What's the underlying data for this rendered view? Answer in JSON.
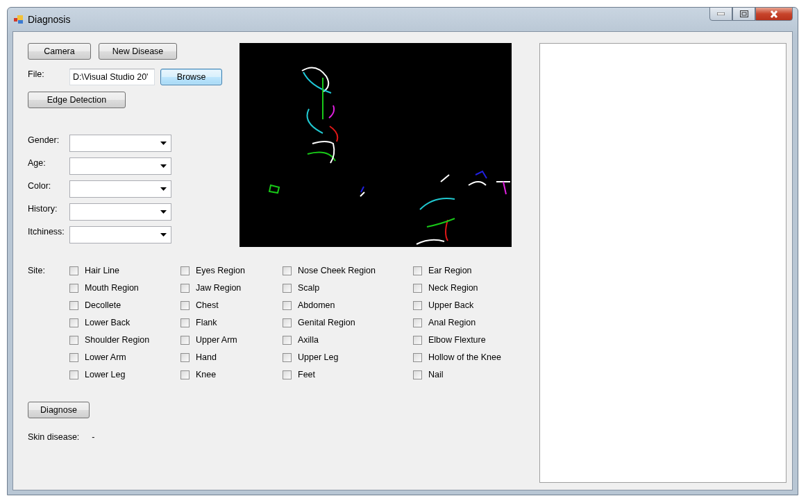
{
  "window": {
    "title": "Diagnosis"
  },
  "top_buttons": [
    "Camera",
    "New Disease"
  ],
  "file": {
    "label": "File:",
    "value": "D:\\Visual Studio 20'",
    "button": "Browse"
  },
  "edge_button": "Edge Detection",
  "preview": {
    "kind": "picture"
  },
  "fields": [
    {
      "label": "Gender:"
    },
    {
      "label": "Age:"
    },
    {
      "label": "Color:"
    },
    {
      "label": "History:"
    },
    {
      "label": "Itchiness:"
    }
  ],
  "site_label": "Site:",
  "sites": [
    [
      {
        "label": "Hair Line",
        "checked": false
      },
      {
        "label": "Eyes Region",
        "checked": false
      },
      {
        "label": "Nose Cheek Region",
        "checked": false
      },
      {
        "label": "Ear Region",
        "checked": false
      }
    ],
    [
      {
        "label": "Mouth Region",
        "checked": false
      },
      {
        "label": "Jaw Region",
        "checked": false
      },
      {
        "label": "Scalp",
        "checked": false
      },
      {
        "label": "Neck Region",
        "checked": false
      }
    ],
    [
      {
        "label": "Decollete",
        "checked": false
      },
      {
        "label": "Chest",
        "checked": false
      },
      {
        "label": "Abdomen",
        "checked": false
      },
      {
        "label": "Upper Back",
        "checked": false
      }
    ],
    [
      {
        "label": "Lower Back",
        "checked": false
      },
      {
        "label": "Flank",
        "checked": false
      },
      {
        "label": "Genital Region",
        "checked": false
      },
      {
        "label": "Anal Region",
        "checked": false
      }
    ],
    [
      {
        "label": "Shoulder Region",
        "checked": false
      },
      {
        "label": "Upper Arm",
        "checked": false
      },
      {
        "label": "Axilla",
        "checked": false
      },
      {
        "label": "Elbow Flexture",
        "checked": false
      }
    ],
    [
      {
        "label": "Lower Arm",
        "checked": false
      },
      {
        "label": "Hand",
        "checked": false
      },
      {
        "label": "Upper Leg",
        "checked": false
      },
      {
        "label": "Hollow of the Knee",
        "checked": false
      }
    ],
    [
      {
        "label": "Lower Leg",
        "checked": false
      },
      {
        "label": "Knee",
        "checked": false
      },
      {
        "label": "Feet",
        "checked": false
      },
      {
        "label": "Nail",
        "checked": false
      }
    ]
  ],
  "diagnose_button": "Diagnose",
  "result": {
    "label": "Skin disease:",
    "value": "-"
  }
}
